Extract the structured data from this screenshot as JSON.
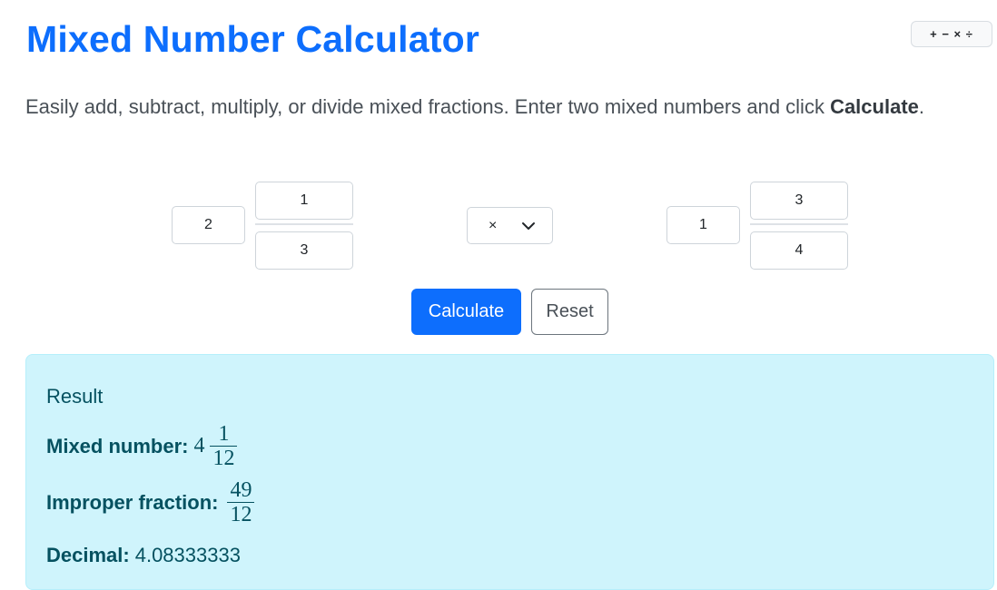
{
  "page": {
    "title": "Mixed Number Calculator",
    "ops_badge": "+ − × ÷",
    "description_text": "Easily add, subtract, multiply, or divide mixed fractions. Enter two mixed numbers and click ",
    "description_bold": "Calculate",
    "description_end": "."
  },
  "first": {
    "whole": "2",
    "numerator": "1",
    "denominator": "3"
  },
  "operator": {
    "selected": "×"
  },
  "second": {
    "whole": "1",
    "numerator": "3",
    "denominator": "4"
  },
  "buttons": {
    "calculate": "Calculate",
    "reset": "Reset"
  },
  "result": {
    "heading": "Result",
    "mixed_label": "Mixed number:",
    "mixed_whole": "4",
    "mixed_numerator": "1",
    "mixed_denominator": "12",
    "improper_label": "Improper fraction:",
    "improper_numerator": "49",
    "improper_denominator": "12",
    "decimal_label": "Decimal:",
    "decimal_value": "4.08333333"
  },
  "colors": {
    "primary": "#0d6efd",
    "result_bg": "#cff4fc",
    "result_text": "#055160"
  }
}
